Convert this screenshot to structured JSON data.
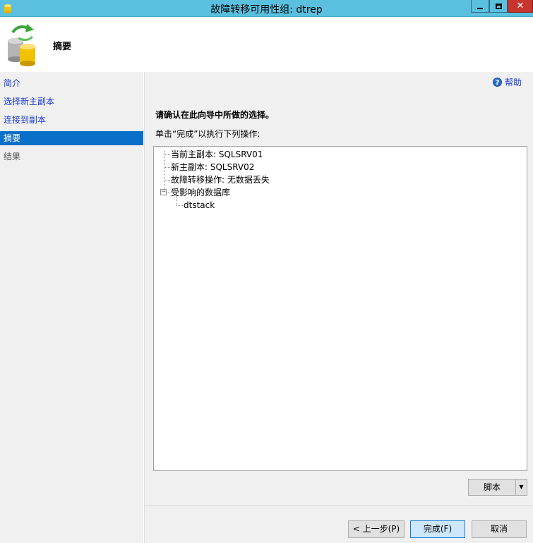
{
  "window": {
    "title": "故障转移可用性组: dtrep"
  },
  "header": {
    "heading": "摘要"
  },
  "nav": {
    "items": [
      {
        "label": "简介"
      },
      {
        "label": "选择新主副本"
      },
      {
        "label": "连接到副本"
      },
      {
        "label": "摘要"
      },
      {
        "label": "结果"
      }
    ],
    "selected_index": 3
  },
  "content": {
    "help": "帮助",
    "confirm": "请确认在此向导中所做的选择。",
    "instruction": "单击“完成”以执行下列操作:",
    "tree": {
      "current_primary": "当前主副本: SQLSRV01",
      "new_primary": "新主副本: SQLSRV02",
      "failover_action": "故障转移操作: 无数据丢失",
      "affected_db": "受影响的数据库",
      "db_name": "dtstack"
    },
    "script_button": "脚本"
  },
  "footer": {
    "back": "< 上一步(P)",
    "finish": "完成(F)",
    "cancel": "取消"
  },
  "colors": {
    "titlebar": "#5bc0e0",
    "selected_nav": "#0a6fc8",
    "link": "#1a3ccc",
    "close_button": "#c7352e"
  }
}
